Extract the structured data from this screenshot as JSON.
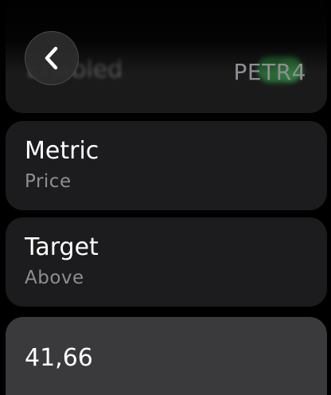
{
  "header": {
    "title": "PETR4",
    "back_icon": "chevron-left-icon"
  },
  "enabled_row": {
    "label": "Enabled",
    "toggle_on": true,
    "toggle_color": "#34c759"
  },
  "metric_row": {
    "title": "Metric",
    "value": "Price"
  },
  "target_row": {
    "title": "Target",
    "value": "Above"
  },
  "value_input": {
    "value": "41,66"
  }
}
